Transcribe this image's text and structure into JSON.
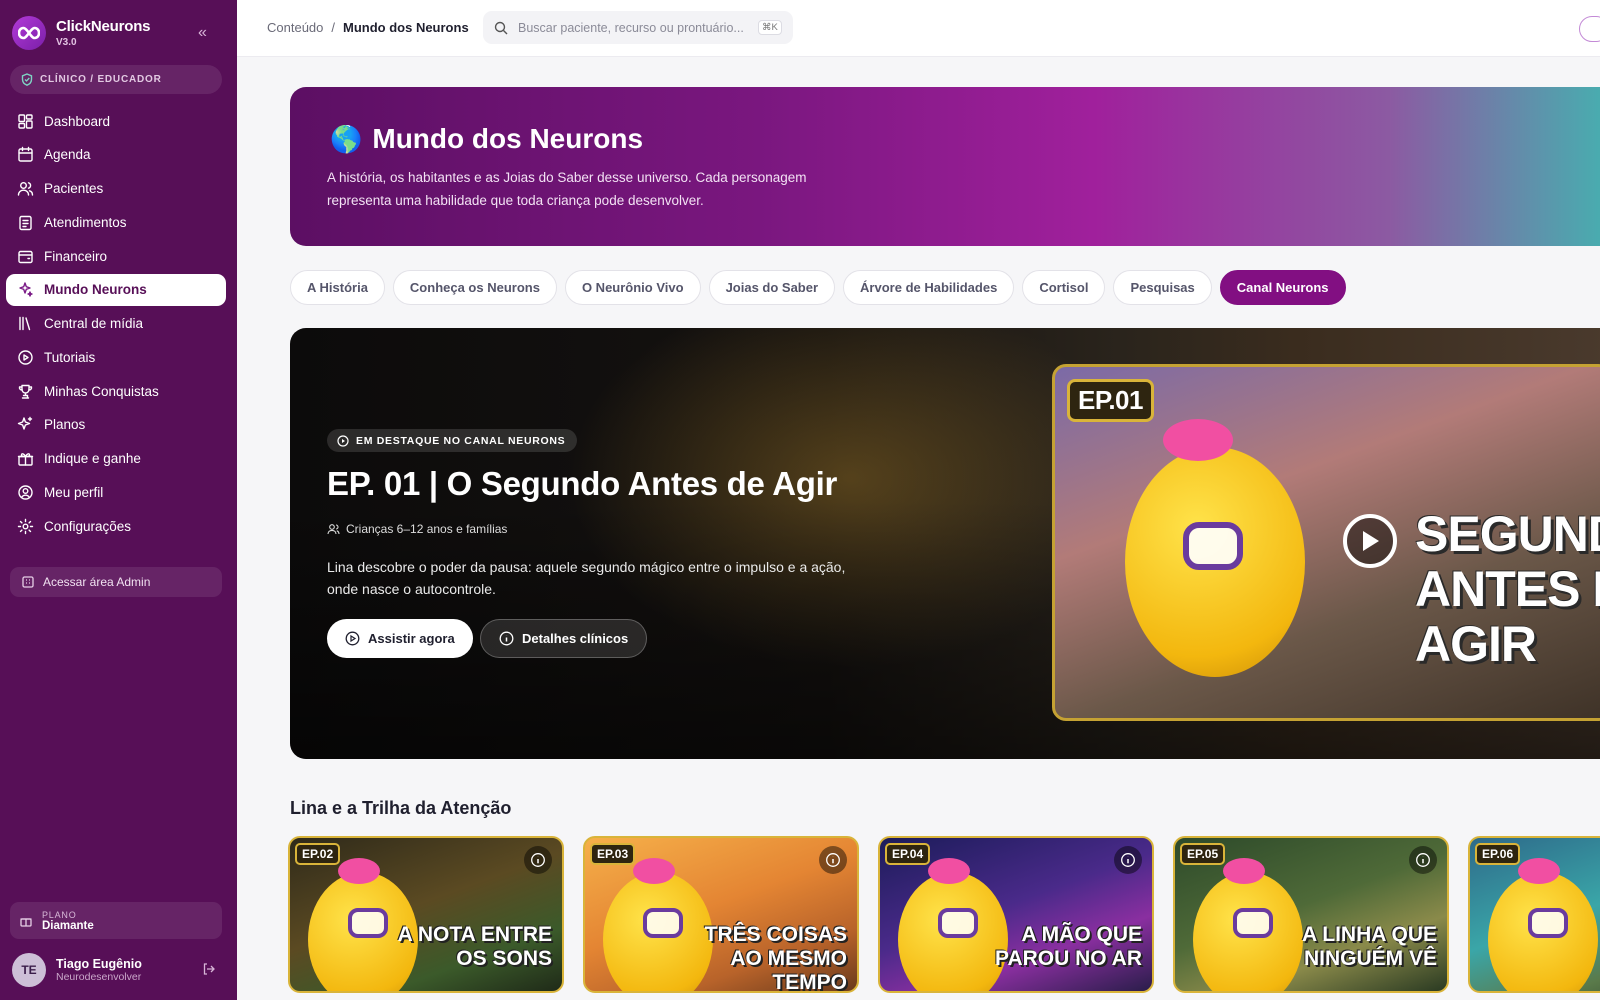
{
  "brand": {
    "name": "ClickNeurons",
    "version": "V3.0"
  },
  "role": "CLÍNICO / EDUCADOR",
  "nav": [
    {
      "label": "Dashboard",
      "icon": "dashboard-icon",
      "active": false
    },
    {
      "label": "Agenda",
      "icon": "calendar-icon",
      "active": false
    },
    {
      "label": "Pacientes",
      "icon": "users-icon",
      "active": false
    },
    {
      "label": "Atendimentos",
      "icon": "clipboard-icon",
      "active": false
    },
    {
      "label": "Financeiro",
      "icon": "wallet-icon",
      "active": false
    },
    {
      "label": "Mundo Neurons",
      "icon": "sparkles-icon",
      "active": true
    },
    {
      "label": "Central de mídia",
      "icon": "library-icon",
      "active": false
    },
    {
      "label": "Tutoriais",
      "icon": "play-circle-icon",
      "active": false
    },
    {
      "label": "Minhas Conquistas",
      "icon": "trophy-icon",
      "active": false
    },
    {
      "label": "Planos",
      "icon": "sparkle-icon",
      "active": false
    },
    {
      "label": "Indique e ganhe",
      "icon": "gift-icon",
      "active": false
    },
    {
      "label": "Meu perfil",
      "icon": "user-circle-icon",
      "active": false
    },
    {
      "label": "Configurações",
      "icon": "gear-icon",
      "active": false
    }
  ],
  "admin_label": "Acessar área Admin",
  "plan": {
    "label": "PLANO",
    "value": "Diamante"
  },
  "user": {
    "initials": "TE",
    "name": "Tiago Eugênio",
    "role": "Neurodesenvolver"
  },
  "breadcrumb": {
    "parent": "Conteúdo",
    "separator": "/",
    "current": "Mundo dos Neurons"
  },
  "search": {
    "placeholder": "Buscar paciente, recurso ou prontuário...",
    "shortcut": "⌘K"
  },
  "hero": {
    "emoji": "🌎",
    "title": "Mundo dos Neurons",
    "subtitle": "A história, os habitantes e as Joias do Saber desse universo. Cada personagem representa uma habilidade que toda criança pode desenvolver."
  },
  "tabs": [
    {
      "label": "A História",
      "active": false
    },
    {
      "label": "Conheça os Neurons",
      "active": false
    },
    {
      "label": "O Neurônio Vivo",
      "active": false
    },
    {
      "label": "Joias do Saber",
      "active": false
    },
    {
      "label": "Árvore de Habilidades",
      "active": false
    },
    {
      "label": "Cortisol",
      "active": false
    },
    {
      "label": "Pesquisas",
      "active": false
    },
    {
      "label": "Canal Neurons",
      "active": true
    }
  ],
  "featured": {
    "badge": "EM DESTAQUE NO CANAL NEURONS",
    "title": "EP. 01 | O Segundo Antes de Agir",
    "audience": "Crianças 6–12 anos e famílias",
    "description": "Lina descobre o poder da pausa: aquele segundo mágico entre o impulso e a ação, onde nasce o autocontrole.",
    "watch_label": "Assistir agora",
    "details_label": "Detalhes clínicos",
    "thumb_ep": "EP.01",
    "thumb_text_1": "SEGUNDO",
    "thumb_text_2": "ANTES DE AGIR"
  },
  "section": {
    "title": "Lina e a Trilha da Atenção"
  },
  "episodes": [
    {
      "ep": "EP.02",
      "text": "A nota entre os sons"
    },
    {
      "ep": "EP.03",
      "text": "Três coisas ao mesmo tempo"
    },
    {
      "ep": "EP.04",
      "text": "A mão que parou no ar"
    },
    {
      "ep": "EP.05",
      "text": "A linha que ninguém vê"
    },
    {
      "ep": "EP.06",
      "text": ""
    }
  ],
  "colors": {
    "sidebar": "#570f57",
    "accent": "#820f82",
    "gold": "#d9b43a"
  }
}
